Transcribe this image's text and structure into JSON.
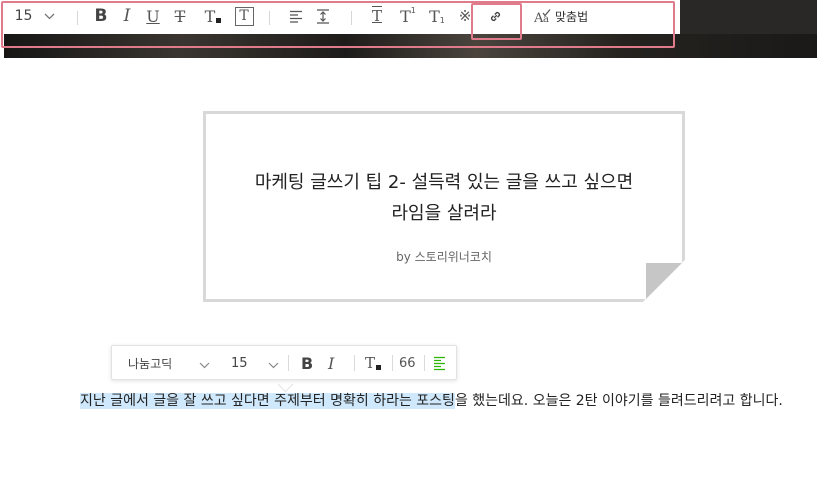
{
  "toolbar": {
    "font_size": "15",
    "bold_label": "B",
    "italic_label": "I",
    "underline_label": "U",
    "strike_label": "T",
    "text_color_label": "T",
    "bg_color_label": "T",
    "line_height_label": "T",
    "superscript_label": "T",
    "superscript_mark": "1",
    "subscript_label": "T",
    "subscript_mark": "1",
    "special_char": "※",
    "spellcheck_label": "맞춤법"
  },
  "quote": {
    "title_line1": "마케팅 글쓰기 팁 2- 설득력 있는 글을 쓰고 싶으면",
    "title_line2": "라임을 살려라",
    "author": "by 스토리위너코치"
  },
  "floating_toolbar": {
    "font_name": "나눔고딕",
    "font_size": "15",
    "bold_label": "B",
    "italic_label": "I",
    "text_color_label": "T",
    "quote_label": "66",
    "accent_color": "#2db400"
  },
  "body": {
    "selected_text": "지난 글에서 글을 잘 쓰고 싶다면 주제부터 명확히 하라는 포스팅",
    "rest_text": "을 했는데요. 오늘은 2탄 이야기를 들려드리려고 합니다."
  },
  "colors": {
    "highlight_box": "#e07b8b",
    "selection": "#cfe8fb"
  }
}
